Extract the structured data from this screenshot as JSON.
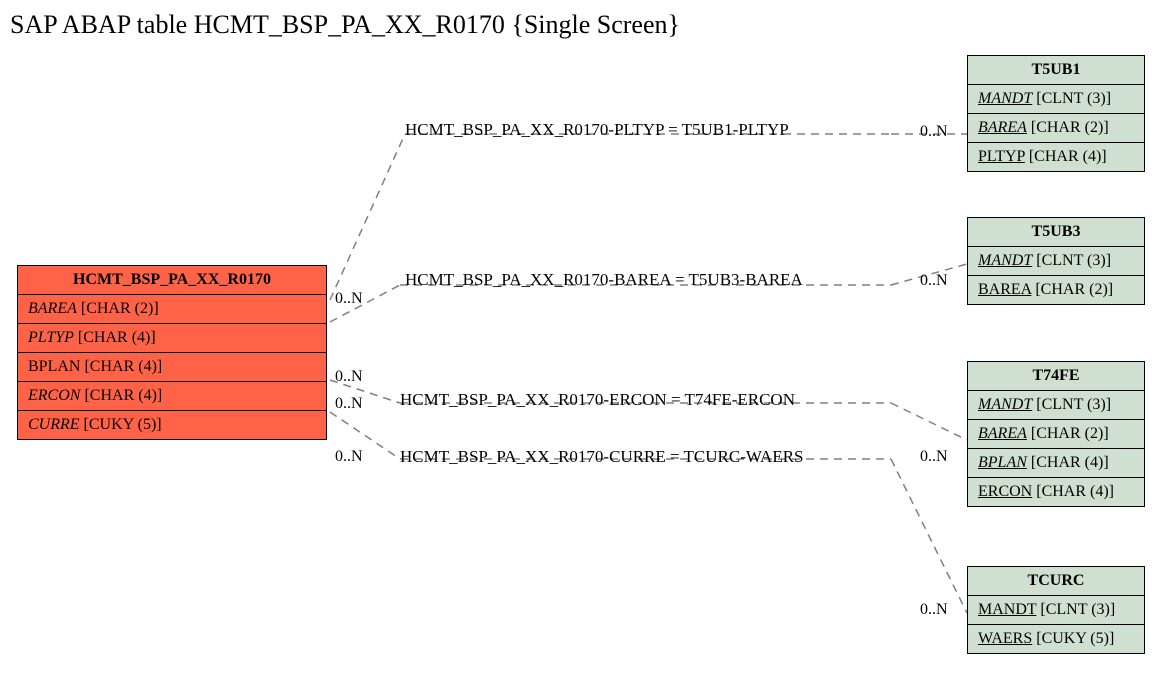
{
  "title": "SAP ABAP table HCMT_BSP_PA_XX_R0170 {Single Screen}",
  "main": {
    "name": "HCMT_BSP_PA_XX_R0170",
    "fields": [
      {
        "name": "BAREA",
        "type": "[CHAR (2)]",
        "italic": true
      },
      {
        "name": "PLTYP",
        "type": "[CHAR (4)]",
        "italic": true
      },
      {
        "name": "BPLAN",
        "type": "[CHAR (4)]",
        "italic": false
      },
      {
        "name": "ERCON",
        "type": "[CHAR (4)]",
        "italic": true
      },
      {
        "name": "CURRE",
        "type": "[CUKY (5)]",
        "italic": true
      }
    ]
  },
  "refs": [
    {
      "name": "T5UB1",
      "fields": [
        {
          "name": "MANDT",
          "type": "[CLNT (3)]",
          "italic": true,
          "underline": true
        },
        {
          "name": "BAREA",
          "type": "[CHAR (2)]",
          "italic": true,
          "underline": true
        },
        {
          "name": "PLTYP",
          "type": "[CHAR (4)]",
          "italic": false,
          "underline": true
        }
      ]
    },
    {
      "name": "T5UB3",
      "fields": [
        {
          "name": "MANDT",
          "type": "[CLNT (3)]",
          "italic": true,
          "underline": true
        },
        {
          "name": "BAREA",
          "type": "[CHAR (2)]",
          "italic": false,
          "underline": true
        }
      ]
    },
    {
      "name": "T74FE",
      "fields": [
        {
          "name": "MANDT",
          "type": "[CLNT (3)]",
          "italic": true,
          "underline": true
        },
        {
          "name": "BAREA",
          "type": "[CHAR (2)]",
          "italic": true,
          "underline": true
        },
        {
          "name": "BPLAN",
          "type": "[CHAR (4)]",
          "italic": true,
          "underline": true
        },
        {
          "name": "ERCON",
          "type": "[CHAR (4)]",
          "italic": false,
          "underline": true
        }
      ]
    },
    {
      "name": "TCURC",
      "fields": [
        {
          "name": "MANDT",
          "type": "[CLNT (3)]",
          "italic": false,
          "underline": true
        },
        {
          "name": "WAERS",
          "type": "[CUKY (5)]",
          "italic": false,
          "underline": true
        }
      ]
    }
  ],
  "rels": [
    {
      "label": "HCMT_BSP_PA_XX_R0170-PLTYP = T5UB1-PLTYP",
      "leftCard": "0..N",
      "rightCard": "0..N"
    },
    {
      "label": "HCMT_BSP_PA_XX_R0170-BAREA = T5UB3-BAREA",
      "leftCard": "0..N",
      "rightCard": "0..N"
    },
    {
      "label": "HCMT_BSP_PA_XX_R0170-ERCON = T74FE-ERCON",
      "leftCard": "0..N",
      "rightCard": "0..N"
    },
    {
      "label": "HCMT_BSP_PA_XX_R0170-CURRE = TCURC-WAERS",
      "leftCard": "0..N",
      "rightCard": "0..N"
    }
  ]
}
